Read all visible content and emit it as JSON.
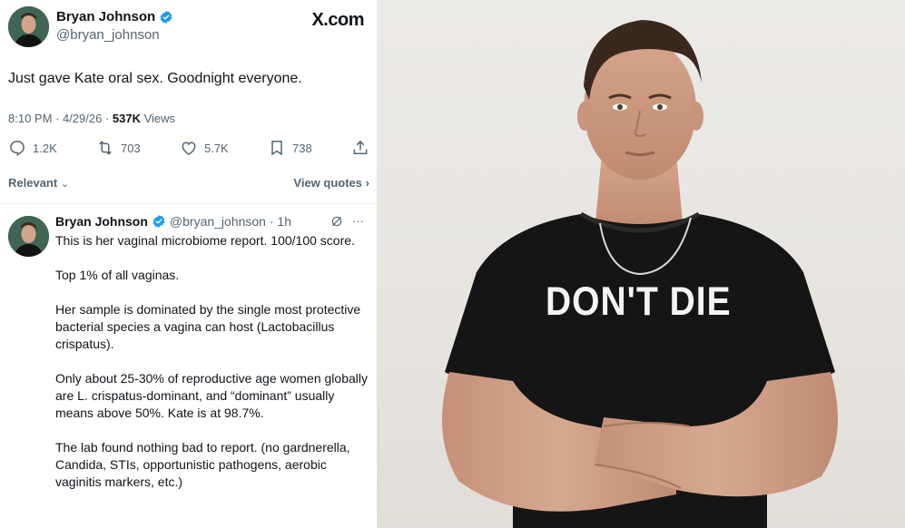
{
  "site": "X.com",
  "tweet": {
    "author_name": "Bryan Johnson",
    "author_handle": "@bryan_johnson",
    "text": "Just gave Kate oral sex. Goodnight everyone.",
    "time": "8:10 PM · 4/29/26 · ",
    "views_count": "537K",
    "views_label": " Views",
    "actions": {
      "replies": "1.2K",
      "reposts": "703",
      "likes": "5.7K",
      "bookmarks": "738"
    },
    "sort_label": "Relevant",
    "view_quotes": "View quotes"
  },
  "reply": {
    "author_name": "Bryan Johnson",
    "author_handle": "@bryan_johnson · 1h",
    "more": "···",
    "paragraphs": [
      "This is her vaginal microbiome report. 100/100 score.",
      "Top 1% of all vaginas.",
      "Her sample is dominated by the single most protective bacterial species a vagina can host (Lactobacillus crispatus).",
      "Only about 25-30% of reproductive age women globally are L. crispatus-dominant, and “dominant” usually means above 50%. Kate is at 98.7%.",
      "The lab found nothing bad to report. (no gardnerella, Candida, STIs, opportunistic pathogens, aerobic vaginitis markers, etc.)"
    ]
  },
  "photo": {
    "shirt_text": "DON'T DIE"
  },
  "colors": {
    "verified": "#1d9bf0",
    "muted": "#536471",
    "text": "#0f1419",
    "shirt": "#151515",
    "skin": "#c99a82"
  }
}
